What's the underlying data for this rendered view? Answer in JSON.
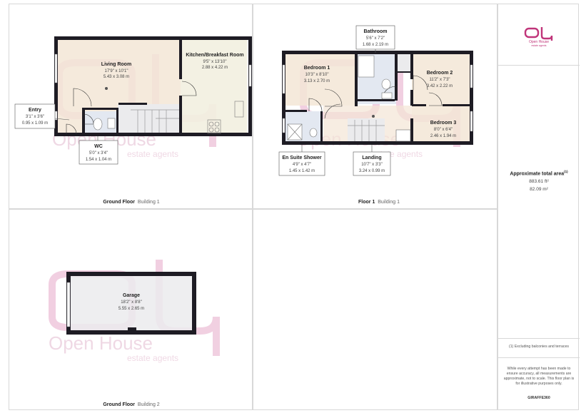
{
  "colors": {
    "wall": "#1e1c24",
    "floor_beige": "#f3e6d6",
    "floor_kitchen": "#f2efe0",
    "floor_grey": "#ebebed",
    "floor_blue": "#e3e8f1",
    "window": "#ffffff",
    "watermark": "#e6a9c9",
    "brand": "#c0357a"
  },
  "ground_floor_1": {
    "caption_floor": "Ground Floor",
    "caption_building": "Building 1",
    "rooms": {
      "living_room": {
        "name": "Living Room",
        "imperial": "17'9\" x 10'1\"",
        "metric": "5.43 x 3.08 m"
      },
      "kitchen": {
        "name": "Kitchen/Breakfast Room",
        "imperial": "9'5\" x 13'10\"",
        "metric": "2.88 x 4.22 m"
      },
      "entry": {
        "name": "Entry",
        "imperial": "3'1\" x 3'6\"",
        "metric": "0.95 x 1.09 m"
      },
      "wc": {
        "name": "WC",
        "imperial": "5'0\" x 3'4\"",
        "metric": "1.54 x 1.04 m"
      }
    }
  },
  "floor_1": {
    "caption_floor": "Floor 1",
    "caption_building": "Building 1",
    "rooms": {
      "bathroom": {
        "name": "Bathroom",
        "imperial": "5'6\" x 7'2\"",
        "metric": "1.68 x 2.19 m"
      },
      "bedroom1": {
        "name": "Bedroom 1",
        "imperial": "10'3\" x 8'10\"",
        "metric": "3.13 x 2.70 m"
      },
      "bedroom2": {
        "name": "Bedroom 2",
        "imperial": "11'2\" x 7'3\"",
        "metric": "3.42 x 2.22 m"
      },
      "bedroom3": {
        "name": "Bedroom 3",
        "imperial": "8'0\" x 6'4\"",
        "metric": "2.46 x 1.94 m"
      },
      "ensuite": {
        "name": "En Suite Shower",
        "imperial": "4'9\" x 4'7\"",
        "metric": "1.45 x 1.42 m"
      },
      "landing": {
        "name": "Landing",
        "imperial": "10'7\" x 3'3\"",
        "metric": "3.24 x 0.99 m"
      }
    }
  },
  "ground_floor_2": {
    "caption_floor": "Ground Floor",
    "caption_building": "Building 2",
    "rooms": {
      "garage": {
        "name": "Garage",
        "imperial": "18'2\" x 8'8\"",
        "metric": "5.55 x 2.65 m"
      }
    }
  },
  "watermark": {
    "brand": "Open House",
    "tagline": "estate agents"
  },
  "sidebar": {
    "logo_text": "Open House",
    "logo_subtext": "estate agents",
    "total_area_title": "Approximate total area",
    "total_area_marker": "(1)",
    "total_area_sqft": "883.61 ft²",
    "total_area_sqm": "82.09 m²",
    "footnote": "(1) Excluding balconies and terraces",
    "disclaimer": "While every attempt has been made to ensure accuracy, all measurements are approximate, not to scale. This floor plan is for illustrative purposes only.",
    "credit": "GIRAFFE360"
  }
}
